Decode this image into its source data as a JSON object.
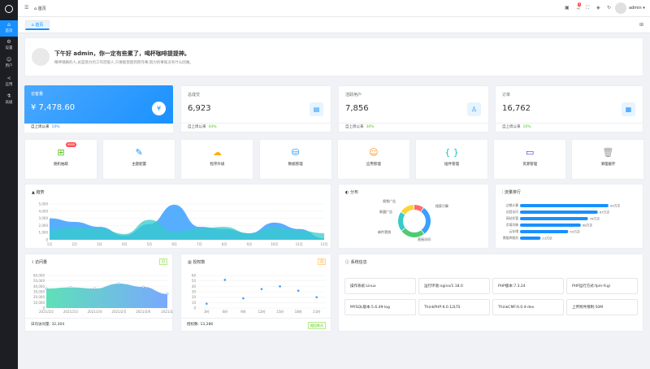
{
  "sidebar": {
    "items": [
      {
        "label": "首页",
        "icon": "home-icon"
      },
      {
        "label": "设置",
        "icon": "gear-icon"
      },
      {
        "label": "用户",
        "icon": "user-icon"
      },
      {
        "label": "应用",
        "icon": "share-icon"
      },
      {
        "label": "高级",
        "icon": "flask-icon"
      }
    ]
  },
  "topbar": {
    "breadcrumb": "首页",
    "user": "admin",
    "notify_count": "3"
  },
  "tabs": [
    {
      "label": "首页"
    }
  ],
  "welcome": {
    "title": "下午好 admin，你一定有些累了，喝杯咖啡提提神。",
    "subtitle": "精神镜赖的人,总是努力的工作足能人,只要能努刮到而作事,努力的事既没有什么因难。"
  },
  "stats": [
    {
      "title": "访客量",
      "value": "¥ 7,478.60",
      "foot": "自上周以来",
      "pct": "10%"
    },
    {
      "title": "总成交",
      "value": "6,923",
      "foot": "自上周以来",
      "pct": "44%"
    },
    {
      "title": "活跃用户",
      "value": "7,856",
      "foot": "自上周以来",
      "pct": "30%"
    },
    {
      "title": "订单",
      "value": "16,762",
      "foot": "自上周以来",
      "pct": "10%"
    }
  ],
  "quick": [
    {
      "label": "随机抽取",
      "icon": "grid-icon",
      "color": "#52c41a",
      "badge": "6888"
    },
    {
      "label": "主题配置",
      "icon": "brush-icon",
      "color": "#1890ff",
      "badge": ""
    },
    {
      "label": "程序升级",
      "icon": "cloud-upload-icon",
      "color": "#faad14",
      "badge": ""
    },
    {
      "label": "数据管理",
      "icon": "database-icon",
      "color": "#1890ff",
      "badge": ""
    },
    {
      "label": "应用管理",
      "icon": "face-icon",
      "color": "#fa8c16",
      "badge": ""
    },
    {
      "label": "插件管理",
      "icon": "braces-icon",
      "color": "#13c2c2",
      "badge": ""
    },
    {
      "label": "资源管理",
      "icon": "archive-icon",
      "color": "#722ed1",
      "badge": ""
    },
    {
      "label": "清理缓存",
      "icon": "trash-icon",
      "color": "#999999",
      "badge": ""
    }
  ],
  "panels": {
    "trend_title": "趋势",
    "dist_title": "分布",
    "rank_title": "流量排行",
    "visit_title": "访问量",
    "visit_tag": "日",
    "auth_title": "授权数",
    "auth_tag": "月",
    "sys_title": "系统信息",
    "visit_foot": "日均访问量: 32,304",
    "auth_foot": "授权数: 13,286",
    "auth_foot_tag": "相比昨天"
  },
  "system": [
    "操作系统:Linux",
    "运行环境:nginx/1.18.0",
    "PHP版本:7.3.24",
    "PHP运行方式:fpm-fcgi",
    "MYSQL版本:5.6.49-log",
    "ThinkPHP:6.0.12LTS",
    "ThinkCMF:6.0.4-dev",
    "上传附件限制:50M"
  ],
  "chart_data": [
    {
      "type": "area",
      "title": "趋势",
      "x": [
        "1月",
        "2月",
        "3月",
        "4月",
        "5月",
        "6月",
        "7月",
        "8月",
        "9月",
        "10月",
        "11月",
        "12月"
      ],
      "ylim": [
        0,
        5000
      ],
      "yticks": [
        "5,000",
        "4,000",
        "3,000",
        "2,000",
        "1,000",
        "0"
      ],
      "series": [
        {
          "values": [
            3000,
            2500,
            1800,
            600,
            2200,
            4900,
            1800,
            1500,
            900,
            2400,
            1500,
            200
          ],
          "color": "#3aa0ff"
        },
        {
          "values": [
            1500,
            1700,
            1600,
            800,
            2800,
            1100,
            1600,
            1800,
            900,
            1700,
            1300,
            900
          ],
          "color": "#36cbcb"
        }
      ]
    },
    {
      "type": "pie",
      "title": "分布",
      "labels": [
        "视频广告",
        "搜索引擎",
        "直接访问",
        "邮件营销",
        "联盟广告"
      ],
      "values": [
        10,
        30,
        25,
        20,
        15
      ],
      "colors": [
        "#ff6b6b",
        "#3aa0ff",
        "#4ecb73",
        "#36cbcb",
        "#fbd437"
      ]
    },
    {
      "type": "bar",
      "title": "流量排行",
      "categories": [
        "边缘计算",
        "远程访问",
        "网站托管",
        "负载均衡",
        "云存储",
        "数据库服务"
      ],
      "values": [
        99,
        87,
        76,
        68,
        54,
        23
      ],
      "labels": [
        "99万次",
        "87万次",
        "76万次",
        "68万次",
        "54万次",
        "23万次"
      ],
      "xlim": [
        0,
        100
      ]
    },
    {
      "type": "area",
      "title": "访问量",
      "x": [
        "2021/2/2",
        "2021/2/3",
        "2021/2/4",
        "2021/2/5",
        "2021/2/6",
        "2021/2/"
      ],
      "ylim": [
        0,
        60000
      ],
      "yticks": [
        "60,000",
        "50,000",
        "40,000",
        "30,000",
        "20,000",
        "10,000",
        "0"
      ],
      "values": [
        36000,
        38000,
        36000,
        45000,
        39000,
        26000
      ]
    },
    {
      "type": "scatter",
      "title": "授权数",
      "x": [
        "3时",
        "6时",
        "9时",
        "12时",
        "15时",
        "18时",
        "21时"
      ],
      "ylim": [
        0,
        60
      ],
      "yticks": [
        "60",
        "50",
        "40",
        "30",
        "20",
        "10",
        "0"
      ],
      "points": [
        [
          3,
          8
        ],
        [
          6,
          52
        ],
        [
          9,
          18
        ],
        [
          12,
          35
        ],
        [
          15,
          40
        ],
        [
          18,
          32
        ],
        [
          21,
          20
        ]
      ]
    }
  ]
}
